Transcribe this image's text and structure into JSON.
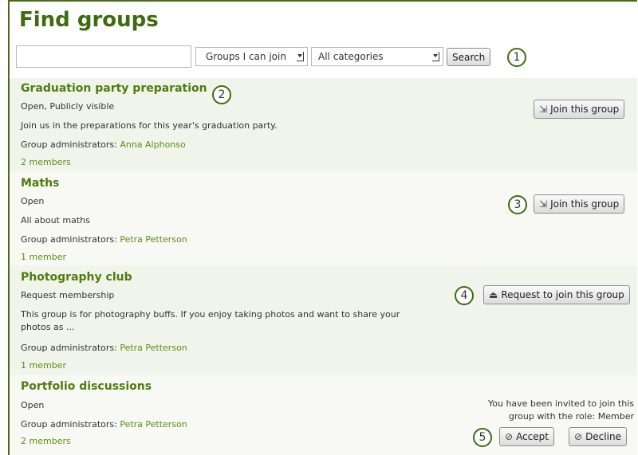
{
  "page": {
    "title": "Find groups"
  },
  "search": {
    "query_value": "",
    "filter_selected": "Groups I can join",
    "category_selected": "All categories",
    "search_label": "Search"
  },
  "callouts": [
    "1",
    "2",
    "3",
    "4",
    "5"
  ],
  "groups": [
    {
      "name": "Graduation party preparation",
      "status": "Open, Publicly visible",
      "description": "Join us in the preparations for this year's graduation party.",
      "admins_label": "Group administrators: ",
      "admin": "Anna Alphonso",
      "members": "2 members",
      "action_label": "Join this group"
    },
    {
      "name": "Maths",
      "status": "Open",
      "description": "All about maths",
      "admins_label": "Group administrators: ",
      "admin": "Petra Petterson",
      "members": "1 member",
      "action_label": "Join this group"
    },
    {
      "name": "Photography club",
      "status": "Request membership",
      "description_line1": "This group is for photography buffs. If you enjoy taking photos and want to share your",
      "description_line2": "photos as ...",
      "admins_label": "Group administrators: ",
      "admin": "Petra Petterson",
      "members": "1 member",
      "action_label": "Request to join this group"
    },
    {
      "name": "Portfolio discussions",
      "status": "Open",
      "admins_label": "Group administrators: ",
      "admin": "Petra Petterson",
      "members": "2 members",
      "invite_line1": "You have been invited to join this",
      "invite_line2": "group with the role: Member",
      "accept_label": "Accept",
      "decline_label": "Decline"
    }
  ],
  "colors": {
    "accent": "#3e6b0f",
    "link": "#5a8f13",
    "row_shade": "#f1f4ea"
  }
}
